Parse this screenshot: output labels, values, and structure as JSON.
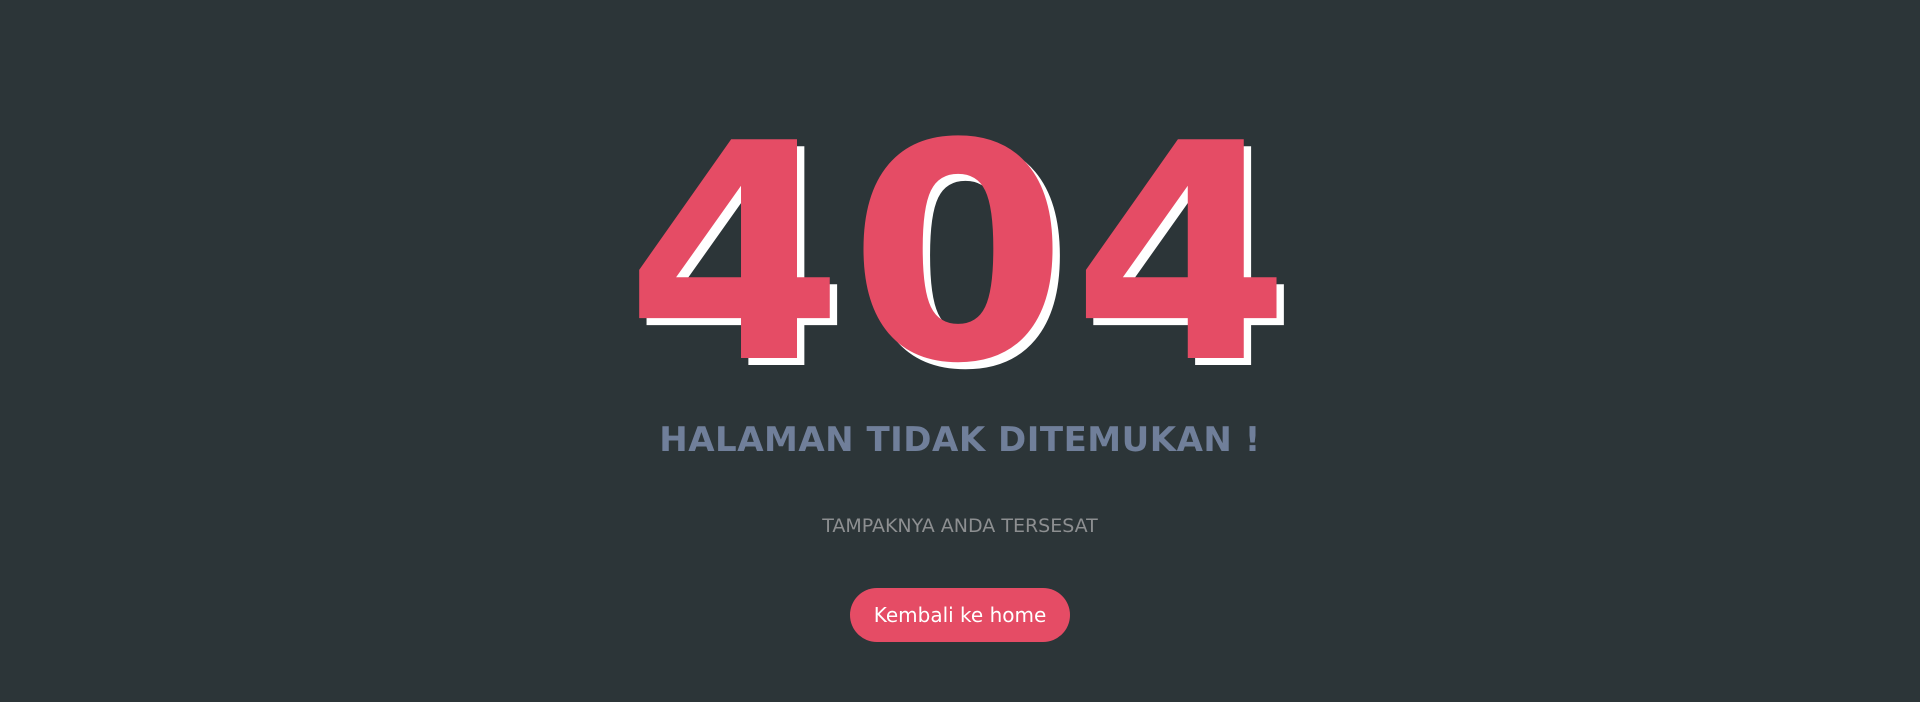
{
  "error": {
    "code": "404",
    "headline": "HALAMAN TIDAK DITEMUKAN !",
    "subline": "TAMPAKNYA ANDA TERSESAT"
  },
  "actions": {
    "home_label": "Kembali ke home"
  },
  "colors": {
    "background": "#2c3538",
    "accent": "#e54c65",
    "shadow": "#ffffff",
    "headline": "#707f9a",
    "subline": "#8d8f91"
  }
}
